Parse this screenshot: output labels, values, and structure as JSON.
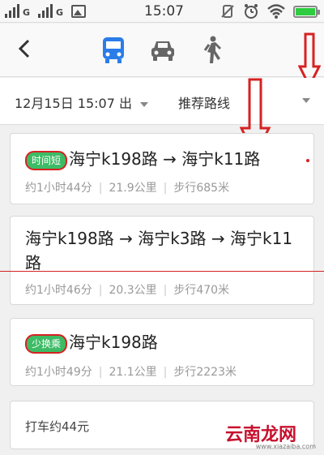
{
  "status_bar": {
    "network1": "G",
    "network2": "G",
    "time": "15:07"
  },
  "nav": {
    "back_icon": "chevron-left-icon",
    "modes": [
      "bus-icon",
      "car-icon",
      "walk-icon"
    ],
    "selected_mode": "bus",
    "accent_color": "#2b7de9"
  },
  "filters": {
    "date_time": "12月15日 15:07 出",
    "route_pref": "推荐路线"
  },
  "routes": [
    {
      "badge": "时间短",
      "title": "海宁k198路 → 海宁k11路",
      "duration": "约1小时44分",
      "distance": "21.9公里",
      "walk": "步行685米"
    },
    {
      "badge": "",
      "title": "海宁k198路 → 海宁k3路 → 海宁k11路",
      "duration": "约1小时46分",
      "distance": "20.3公里",
      "walk": "步行470米"
    },
    {
      "badge": "少换乘",
      "title": "海宁k198路",
      "duration": "约1小时49分",
      "distance": "21.1公里",
      "walk": "步行2223米"
    }
  ],
  "taxi": {
    "label": "打车约44元"
  },
  "watermark": {
    "text": "云南龙网",
    "sub": "www.xiazaiba.com"
  },
  "colors": {
    "badge_green": "#3dbb65",
    "annotation_red": "#d62222"
  }
}
